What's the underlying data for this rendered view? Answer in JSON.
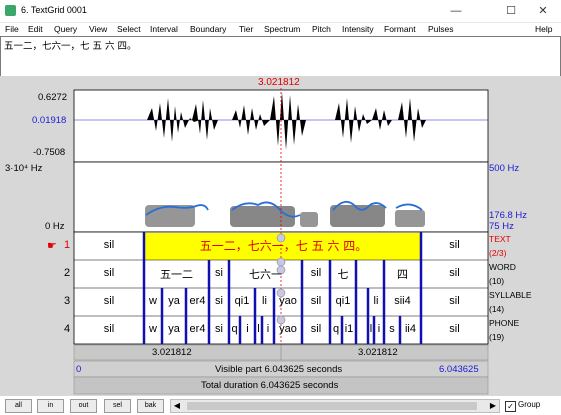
{
  "window": {
    "title": "6. TextGrid 0001",
    "minimize_icon": "minimize-icon",
    "maximize_icon": "maximize-icon",
    "close_icon": "close-icon"
  },
  "menu": [
    "File",
    "Edit",
    "Query",
    "View",
    "Select",
    "Interval",
    "Boundary",
    "Tier",
    "Spectrum",
    "Pitch",
    "Intensity",
    "Formant",
    "Pulses",
    "Help"
  ],
  "text_area": {
    "value": "五一二，七六一，七 五 六 四。"
  },
  "cursor": {
    "time_label": "3.021812"
  },
  "waveform": {
    "max": "0.6272",
    "mid": "0.01918",
    "min": "-0.7508"
  },
  "spectrogram": {
    "top_left": "3·10⁴ Hz",
    "bottom_left": "0 Hz",
    "top_right": "500 Hz",
    "pitch_value": "176.8 Hz",
    "bottom_right": "75 Hz"
  },
  "tiers": [
    {
      "num": "1",
      "name": "TEXT",
      "count": "(2/3)",
      "selected": true,
      "cells": [
        "sil",
        "五一二，七六一，七 五 六 四。",
        "sil"
      ]
    },
    {
      "num": "2",
      "name": "WORD",
      "count": "(10)",
      "selected": false,
      "cells": [
        "sil",
        "五一二",
        "si",
        "七六一",
        "sil",
        "七",
        "四",
        "sil"
      ]
    },
    {
      "num": "3",
      "name": "SYLLABLE",
      "count": "(14)",
      "selected": false,
      "cells": [
        "sil",
        "w",
        "ya",
        "er4",
        "si",
        "qi1",
        "li",
        "yao",
        "sil",
        "qi1",
        "li",
        "sii4",
        "sil"
      ]
    },
    {
      "num": "4",
      "name": "PHONE",
      "count": "(19)",
      "selected": false,
      "cells": [
        "sil",
        "w",
        "ya",
        "er4",
        "si",
        "q",
        "i",
        "l",
        "i",
        "yao",
        "sil",
        "q",
        "i1",
        "l",
        "i",
        "s",
        "ii4",
        "sil"
      ]
    }
  ],
  "time_bar": {
    "left_part": "3.021812",
    "right_part": "3.021812",
    "visible_start": "0",
    "visible_label": "Visible part 6.043625 seconds",
    "visible_end": "6.043625",
    "total_label": "Total duration 6.043625 seconds"
  },
  "buttons": [
    "all",
    "in",
    "out",
    "sel",
    "bak"
  ],
  "group": {
    "label": "Group",
    "checked": true
  },
  "colors": {
    "selected_interval": "#ffff00",
    "text_red": "#e00000",
    "blue_label": "#1a1ad6",
    "boundary_blue": "#1010b0",
    "pitch": "#2a6fd6"
  }
}
